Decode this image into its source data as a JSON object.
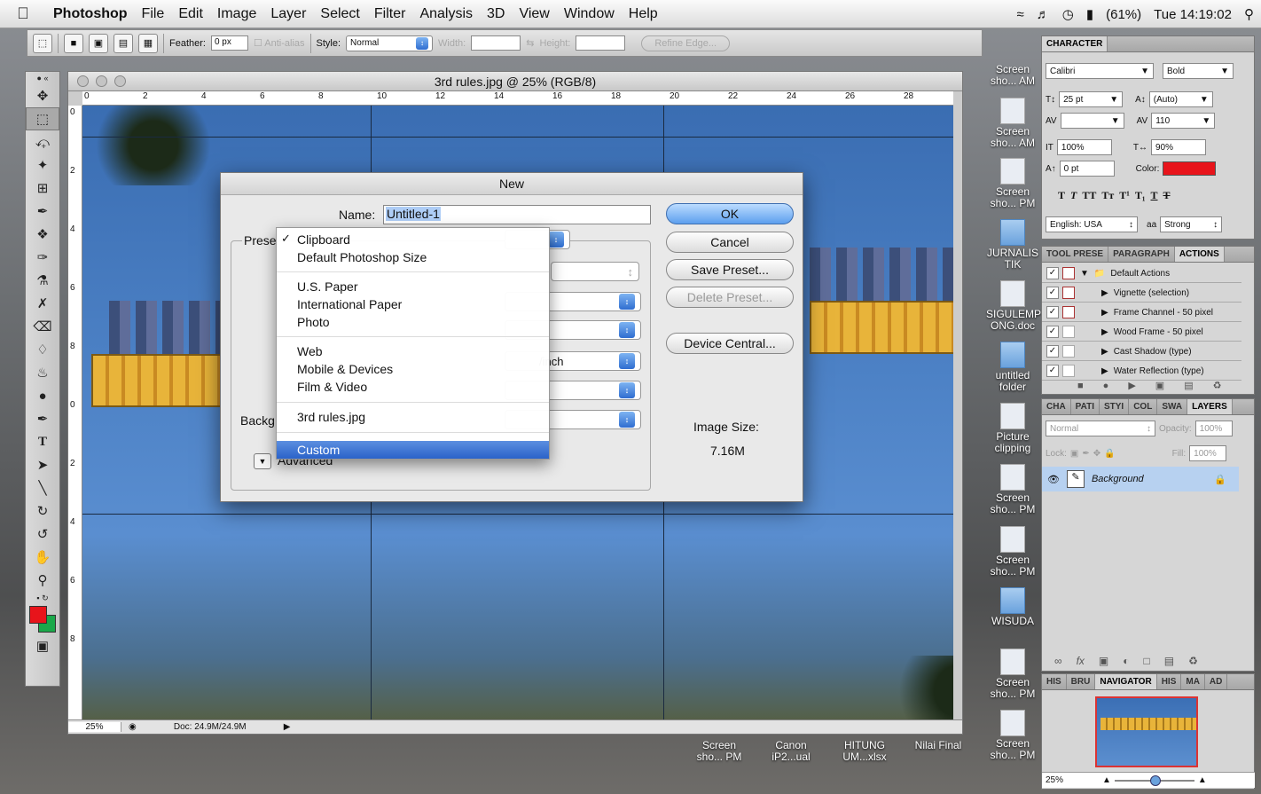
{
  "menubar": {
    "app": "Photoshop",
    "items": [
      "File",
      "Edit",
      "Image",
      "Layer",
      "Select",
      "Filter",
      "Analysis",
      "3D",
      "View",
      "Window",
      "Help"
    ],
    "battery": "(61%)",
    "clock": "Tue 14:19:02"
  },
  "options": {
    "feather_label": "Feather:",
    "feather_value": "0 px",
    "antialias": "Anti-alias",
    "style_label": "Style:",
    "style_value": "Normal",
    "width_label": "Width:",
    "height_label": "Height:",
    "refine": "Refine Edge..."
  },
  "document": {
    "title": "3rd rules.jpg @ 25% (RGB/8)",
    "ruler_h": [
      "0",
      "2",
      "4",
      "6",
      "8",
      "10",
      "12",
      "14",
      "16",
      "18",
      "20",
      "22",
      "24",
      "26",
      "28"
    ],
    "ruler_v": [
      "0",
      "2",
      "4",
      "6",
      "8",
      "0",
      "2",
      "4",
      "6",
      "8"
    ],
    "zoom": "25%",
    "doc_info": "Doc: 24.9M/24.9M"
  },
  "dialog": {
    "title": "New",
    "name_label": "Name:",
    "name_value": "Untitled-1",
    "preset_label": "Prese",
    "background_label": "Backg",
    "advanced_label": "Advanced",
    "resolution_unit": "/inch",
    "buttons": {
      "ok": "OK",
      "cancel": "Cancel",
      "save_preset": "Save Preset...",
      "delete_preset": "Delete Preset...",
      "device_central": "Device Central..."
    },
    "image_size_label": "Image Size:",
    "image_size_value": "7.16M"
  },
  "preset_menu": {
    "items": [
      "Clipboard",
      "Default Photoshop Size",
      "U.S. Paper",
      "International Paper",
      "Photo",
      "Web",
      "Mobile & Devices",
      "Film & Video",
      "3rd rules.jpg",
      "Custom"
    ],
    "checked": "Clipboard",
    "highlighted": "Custom"
  },
  "desktop_icons": [
    {
      "label": "Screen sho... AM"
    },
    {
      "label": "Screen sho... AM"
    },
    {
      "label": "Screen sho... PM"
    },
    {
      "label": "JURNALIS TIK"
    },
    {
      "label": "SIGULEMP ONG.doc"
    },
    {
      "label": "untitled folder"
    },
    {
      "label": "Picture clipping"
    },
    {
      "label": "Screen sho... PM"
    },
    {
      "label": "Screen sho... PM"
    },
    {
      "label": "WISUDA"
    },
    {
      "label": "Screen sho... PM"
    },
    {
      "label": "Screen sho... PM"
    }
  ],
  "bottom_icons": [
    {
      "label": "Screen sho... PM"
    },
    {
      "label": "Canon iP2...ual"
    },
    {
      "label": "HITUNG UM...xlsx"
    },
    {
      "label": "Nilai Final"
    }
  ],
  "character_panel": {
    "tab": "CHARACTER",
    "font": "Calibri",
    "style": "Bold",
    "size": "25 pt",
    "leading": "(Auto)",
    "tracking": "110",
    "vscale": "100%",
    "hscale": "90%",
    "baseline": "0 pt",
    "color_label": "Color:",
    "color": "#e8141b",
    "language": "English: USA",
    "aa_label": "a",
    "antialias": "Strong"
  },
  "actions_panel": {
    "tabs": [
      "TOOL PRESE",
      "PARAGRAPH",
      "ACTIONS"
    ],
    "set": "Default Actions",
    "items": [
      "Vignette (selection)",
      "Frame Channel - 50 pixel",
      "Wood Frame - 50 pixel",
      "Cast Shadow (type)",
      "Water Reflection (type)"
    ]
  },
  "layers_panel": {
    "tabs": [
      "CHA",
      "PATI",
      "STYI",
      "COL",
      "SWA",
      "LAYERS"
    ],
    "blend": "Normal",
    "opacity_label": "Opacity:",
    "opacity": "100%",
    "lock_label": "Lock:",
    "fill_label": "Fill:",
    "fill": "100%",
    "layer": "Background"
  },
  "navigator_panel": {
    "tabs": [
      "HIS",
      "BRU",
      "NAVIGATOR",
      "HIS",
      "MA",
      "AD"
    ],
    "zoom": "25%"
  },
  "colors": {
    "foreground": "#e8141b",
    "background": "#1aa84a",
    "highlight": "#2a62c9"
  }
}
